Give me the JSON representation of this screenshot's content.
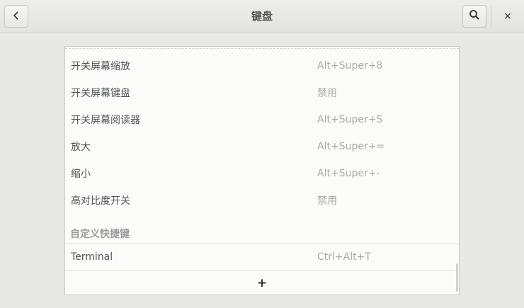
{
  "header": {
    "title": "键盘",
    "back_icon": "chevron-left-icon",
    "search_icon": "search-icon",
    "close_label": "×"
  },
  "shortcuts": [
    {
      "name": "开关屏幕缩放",
      "accel": "Alt+Super+8"
    },
    {
      "name": "开关屏幕键盘",
      "accel": "禁用"
    },
    {
      "name": "开关屏幕阅读器",
      "accel": "Alt+Super+S"
    },
    {
      "name": "放大",
      "accel": "Alt+Super+="
    },
    {
      "name": "缩小",
      "accel": "Alt+Super+-"
    },
    {
      "name": "高对比度开关",
      "accel": "禁用"
    }
  ],
  "custom_section": {
    "title": "自定义快捷键",
    "items": [
      {
        "name": "Terminal",
        "accel": "Ctrl+Alt+T"
      }
    ],
    "add_label": "+"
  }
}
